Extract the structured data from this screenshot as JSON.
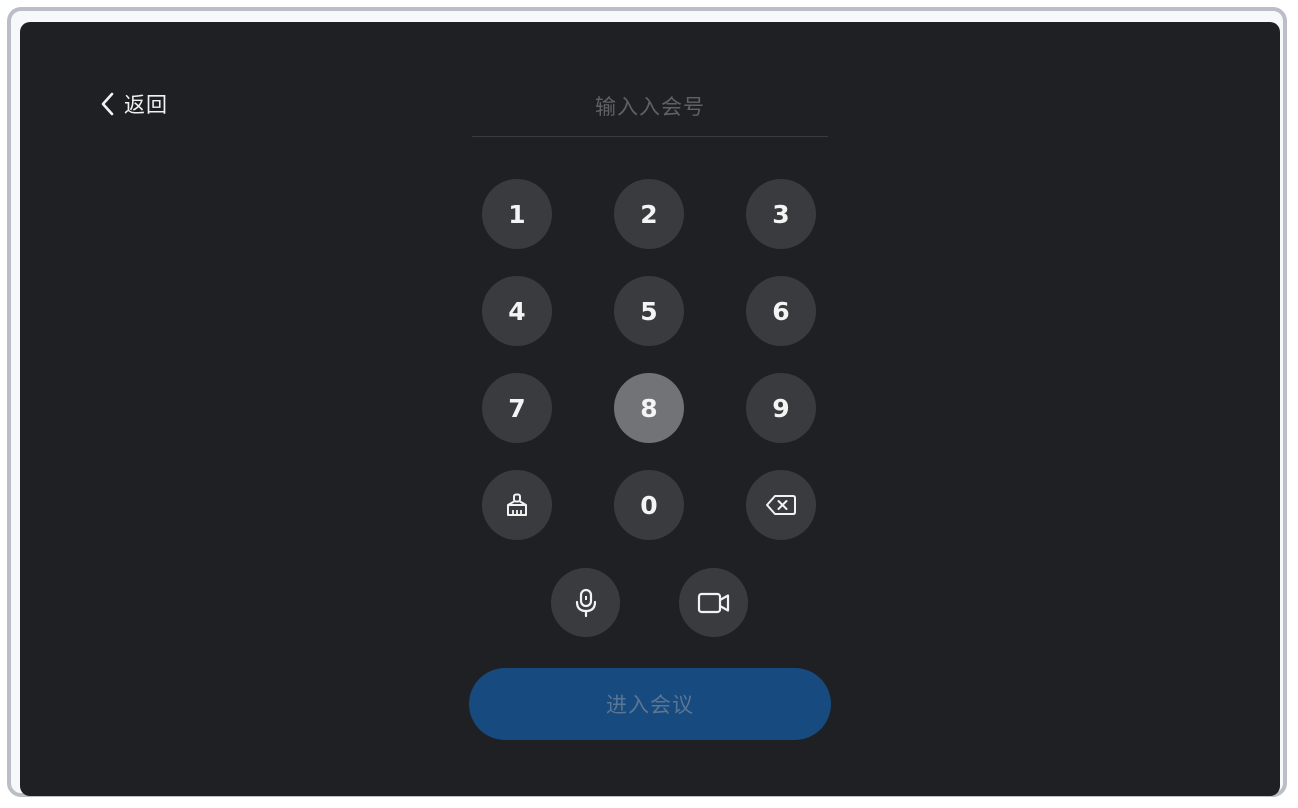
{
  "header": {
    "back_label": "返回",
    "back_icon": "chevron-left-icon"
  },
  "meeting_input": {
    "placeholder": "输入入会号",
    "value": ""
  },
  "keypad": {
    "keys": [
      "1",
      "2",
      "3",
      "4",
      "5",
      "6",
      "7",
      "8",
      "9",
      "0"
    ],
    "active_key": "8",
    "clear_icon": "broom-clear-icon",
    "delete_icon": "backspace-icon"
  },
  "media_toggles": {
    "mic_icon": "microphone-icon",
    "camera_icon": "video-camera-icon"
  },
  "enter_button": {
    "label": "进入会议"
  },
  "colors": {
    "screen_background": "#1f2023",
    "key_background": "#3a3b3f",
    "key_active_background": "#727377",
    "primary_button": "#174a7e",
    "primary_button_text": "#5c7593"
  }
}
